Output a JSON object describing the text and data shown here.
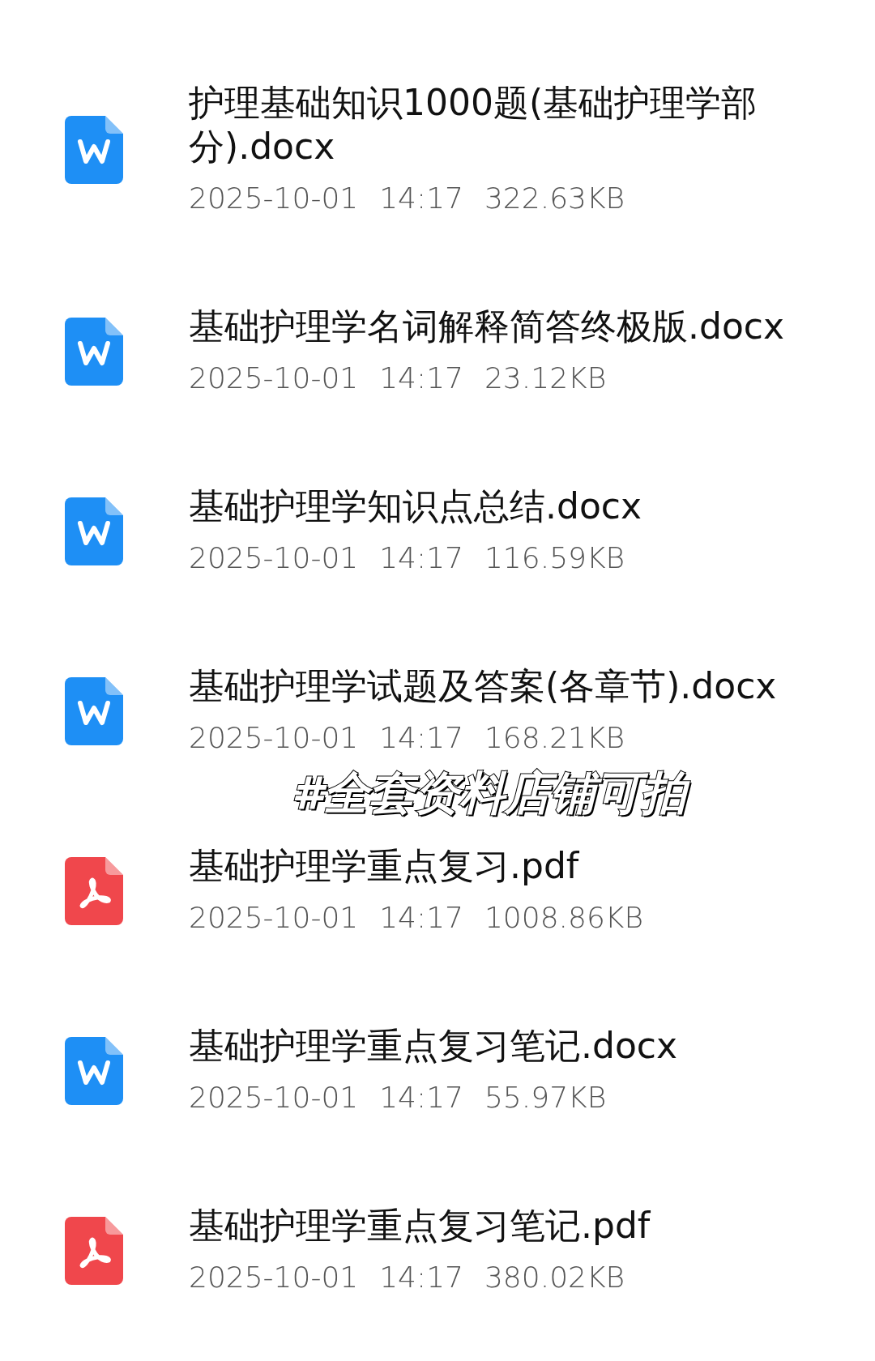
{
  "files": [
    {
      "kind": "word",
      "name": "护理基础知识1000题(基础护理学部分).docx",
      "date": "2025-10-01",
      "time": "14:17",
      "size": "322.63KB"
    },
    {
      "kind": "word",
      "name": "基础护理学名词解释简答终极版.docx",
      "date": "2025-10-01",
      "time": "14:17",
      "size": "23.12KB"
    },
    {
      "kind": "word",
      "name": "基础护理学知识点总结.docx",
      "date": "2025-10-01",
      "time": "14:17",
      "size": "116.59KB"
    },
    {
      "kind": "word",
      "name": "基础护理学试题及答案(各章节).docx",
      "date": "2025-10-01",
      "time": "14:17",
      "size": "168.21KB"
    },
    {
      "kind": "pdf",
      "name": "基础护理学重点复习.pdf",
      "date": "2025-10-01",
      "time": "14:17",
      "size": "1008.86KB"
    },
    {
      "kind": "word",
      "name": "基础护理学重点复习笔记.docx",
      "date": "2025-10-01",
      "time": "14:17",
      "size": "55.97KB"
    },
    {
      "kind": "pdf",
      "name": "基础护理学重点复习笔记.pdf",
      "date": "2025-10-01",
      "time": "14:17",
      "size": "380.02KB"
    }
  ],
  "overlay_caption": "#全套资料店铺可拍"
}
